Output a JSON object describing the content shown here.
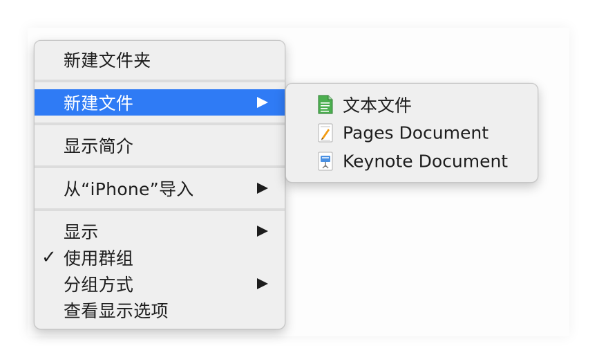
{
  "main_menu": {
    "items": [
      {
        "label": "新建文件夹"
      },
      {
        "label": "新建文件",
        "state": "highlighted",
        "has_submenu": true
      },
      {
        "label": "显示简介"
      },
      {
        "label": "从“iPhone”导入",
        "has_submenu": true
      },
      {
        "label": "显示",
        "has_submenu": true
      },
      {
        "label": "使用群组",
        "checked": true,
        "check_mark": "✓"
      },
      {
        "label": "分组方式",
        "has_submenu": true
      },
      {
        "label": "查看显示选项"
      }
    ]
  },
  "submenu": {
    "items": [
      {
        "label": "文本文件",
        "icon": "text-file-icon"
      },
      {
        "label": "Pages Document",
        "icon": "pages-document-icon"
      },
      {
        "label": "Keynote Document",
        "icon": "keynote-document-icon"
      }
    ]
  },
  "colors": {
    "highlight": "#2f7bf5",
    "menu_background": "#efefef",
    "separator": "#dcdcdc",
    "text": "#1d1d1d"
  }
}
